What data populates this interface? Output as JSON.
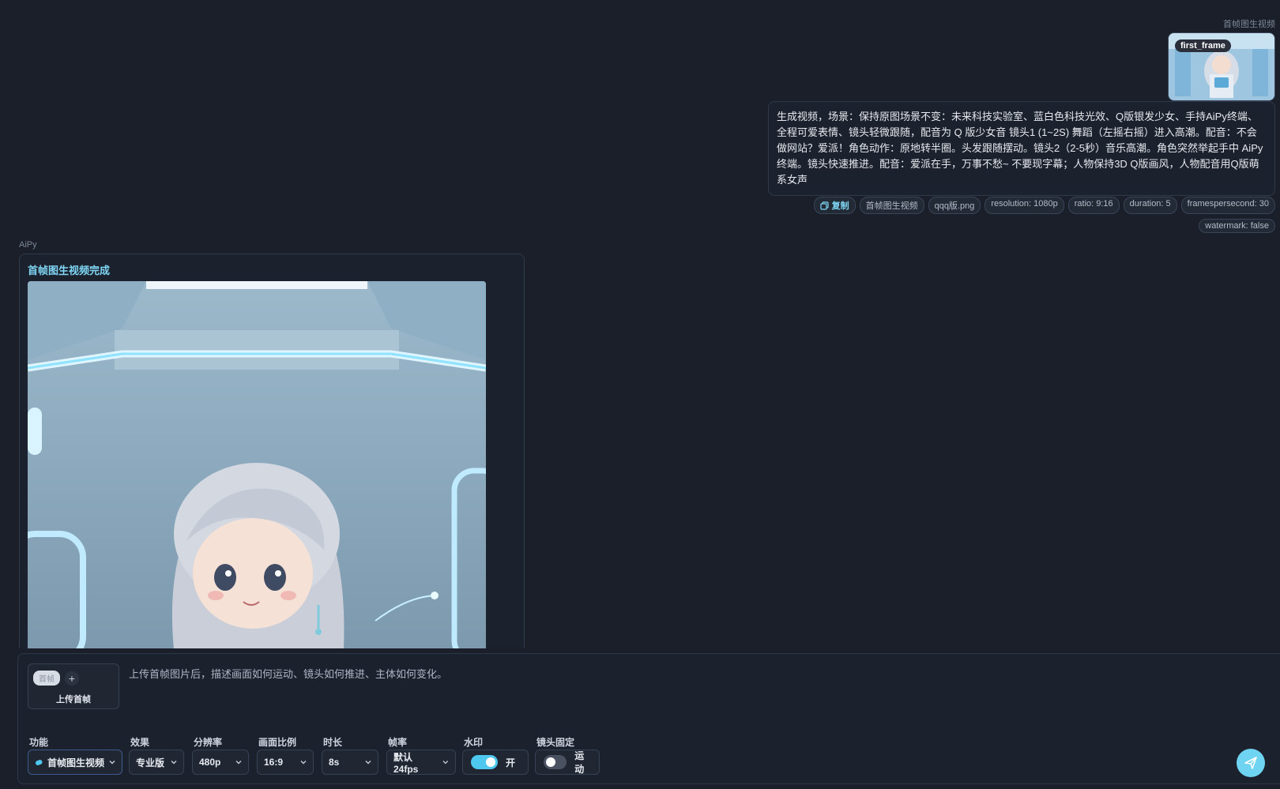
{
  "user_message": {
    "sender": "首帧图生视频",
    "attachment_badge": "first_frame",
    "prompt": "生成视频，场景：保持原图场景不变：未来科技实验室、蓝白色科技光效、Q版银发少女、手持AiPy终端、全程可爱表情、镜头轻微跟随，配音为 Q 版少女音 镜头1 (1~2S) 舞蹈（左摇右摇）进入高潮。配音：不会做网站？爱派！角色动作：原地转半圈。头发跟随摆动。镜头2（2-5秒）音乐高潮。角色突然举起手中 AiPy 终端。镜头快速推进。配音：爱派在手，万事不愁~ 不要现字幕；人物保持3D Q版画风，人物配音用Q版萌系女声",
    "copy_label": "复制",
    "tags": [
      "首帧图生视频",
      "qqq版.png",
      "resolution: 1080p",
      "ratio: 9:16",
      "duration: 5",
      "framespersecond: 30",
      "watermark: false"
    ]
  },
  "ai_message": {
    "sender": "AiPy",
    "title": "首帧图生视频完成"
  },
  "composer": {
    "upload_pill": "首帧",
    "upload_label": "上传首帧",
    "placeholder": "上传首帧图片后，描述画面如何运动、镜头如何推进、主体如何变化。",
    "controls": {
      "function": {
        "label": "功能",
        "value": "首帧图生视频"
      },
      "effect": {
        "label": "效果",
        "value": "专业版"
      },
      "resolution": {
        "label": "分辨率",
        "value": "480p"
      },
      "ratio": {
        "label": "画面比例",
        "value": "16:9"
      },
      "duration": {
        "label": "时长",
        "value": "8s"
      },
      "fps": {
        "label": "帧率",
        "value": "默认 24fps"
      },
      "watermark": {
        "label": "水印",
        "value": "开",
        "on": true
      },
      "camera_fixed": {
        "label": "镜头固定",
        "value": "运动",
        "on": false
      }
    }
  },
  "colors": {
    "accent": "#4fc8f0",
    "background": "#1a1f2a",
    "title": "#7fd6f5"
  }
}
